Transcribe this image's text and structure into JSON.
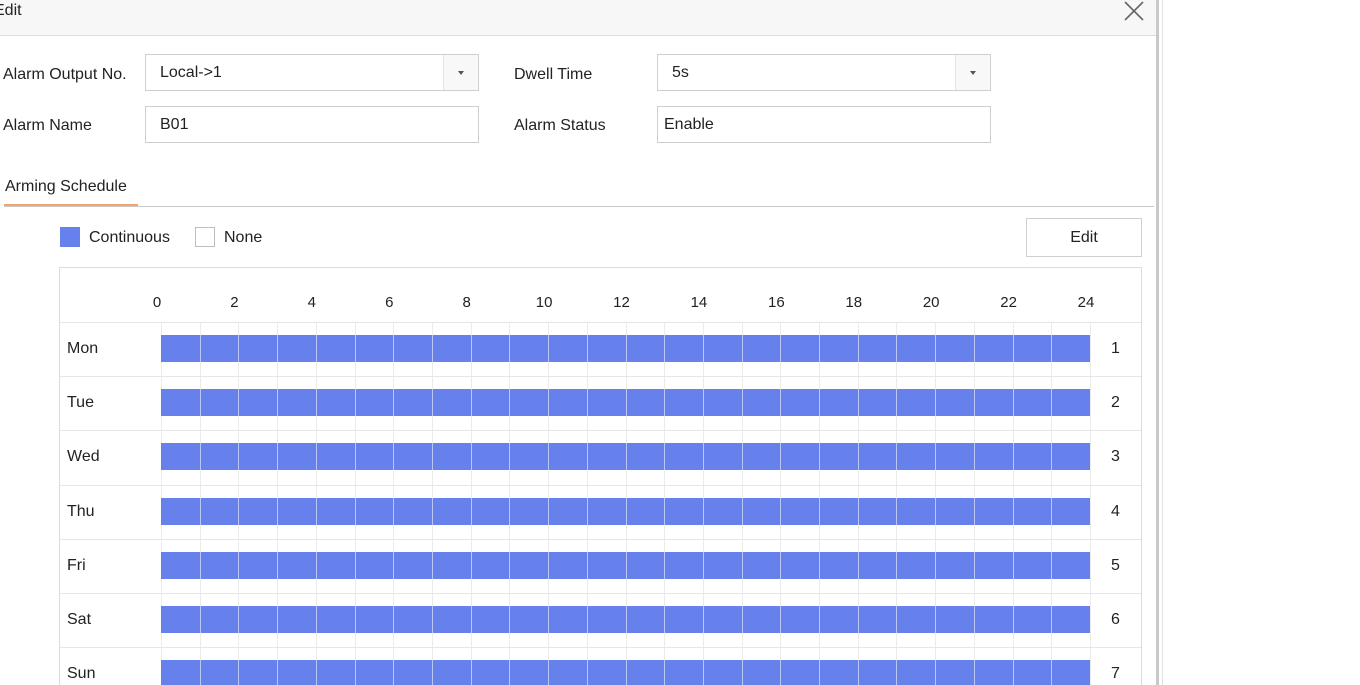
{
  "dialog": {
    "title": "Edit",
    "colors": {
      "schedule_fill": "#6781ec",
      "tab_accent": "#f2a66c"
    }
  },
  "form": {
    "alarm_output_label": "Alarm Output No.",
    "alarm_output_value": "Local->1",
    "dwell_time_label": "Dwell Time",
    "dwell_time_value": "5s",
    "alarm_name_label": "Alarm Name",
    "alarm_name_value": "B01",
    "alarm_status_label": "Alarm Status",
    "alarm_status_value": "Enable"
  },
  "tabs": {
    "arming_schedule": "Arming Schedule"
  },
  "legend": {
    "continuous": "Continuous",
    "none": "None"
  },
  "buttons": {
    "edit": "Edit"
  },
  "schedule": {
    "hours": [
      "0",
      "2",
      "4",
      "6",
      "8",
      "10",
      "12",
      "14",
      "16",
      "18",
      "20",
      "22",
      "24"
    ],
    "rows": [
      {
        "day": "Mon",
        "num": "1",
        "mode": "Continuous",
        "start": 0,
        "end": 24
      },
      {
        "day": "Tue",
        "num": "2",
        "mode": "Continuous",
        "start": 0,
        "end": 24
      },
      {
        "day": "Wed",
        "num": "3",
        "mode": "Continuous",
        "start": 0,
        "end": 24
      },
      {
        "day": "Thu",
        "num": "4",
        "mode": "Continuous",
        "start": 0,
        "end": 24
      },
      {
        "day": "Fri",
        "num": "5",
        "mode": "Continuous",
        "start": 0,
        "end": 24
      },
      {
        "day": "Sat",
        "num": "6",
        "mode": "Continuous",
        "start": 0,
        "end": 24
      },
      {
        "day": "Sun",
        "num": "7",
        "mode": "Continuous",
        "start": 0,
        "end": 24
      }
    ]
  }
}
